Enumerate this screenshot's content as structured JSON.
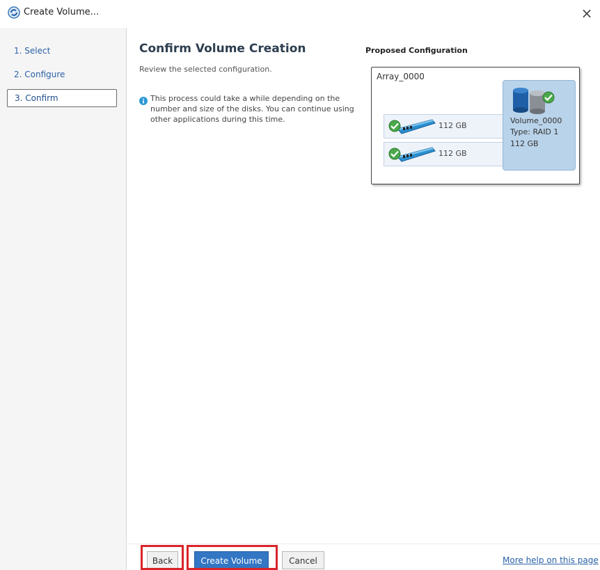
{
  "window": {
    "title": "Create Volume..."
  },
  "sidebar": {
    "items": [
      {
        "label": "1. Select"
      },
      {
        "label": "2. Configure"
      },
      {
        "label": "3. Confirm",
        "active": true
      }
    ]
  },
  "main": {
    "title": "Confirm Volume Creation",
    "subtitle": "Review the selected configuration.",
    "info": "This process could take a while depending on the number and size of the disks. You can continue using other applications during this time."
  },
  "config": {
    "heading": "Proposed Configuration",
    "array_name": "Array_0000",
    "disks": [
      {
        "size": "112 GB"
      },
      {
        "size": "112 GB"
      }
    ],
    "volume": {
      "name": "Volume_0000",
      "type": "Type: RAID 1",
      "size": "112 GB"
    }
  },
  "footer": {
    "back_label": "Back",
    "create_label": "Create Volume",
    "cancel_label": "Cancel",
    "help_link": "More help on this page"
  },
  "colors": {
    "primary_button": "#3276c4",
    "highlight": "#d9242a",
    "link": "#2a62a8",
    "volume_panel": "#b9d3ea"
  }
}
